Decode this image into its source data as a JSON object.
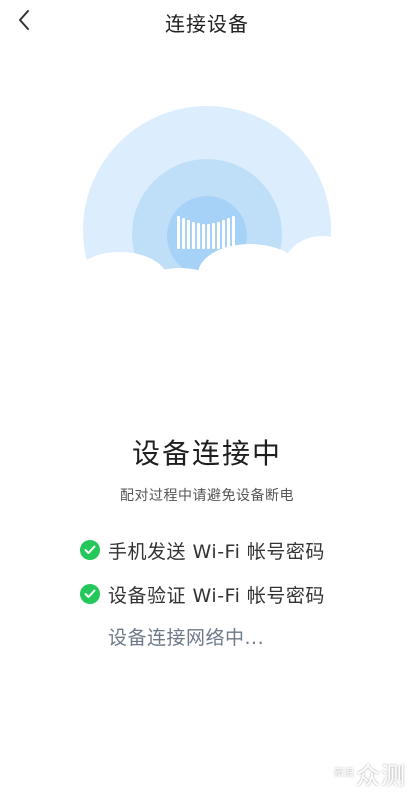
{
  "nav": {
    "title": "连接设备"
  },
  "status": {
    "title": "设备连接中",
    "subtitle": "配对过程中请避免设备断电"
  },
  "steps": [
    {
      "label": "手机发送 Wi-Fi 帐号密码",
      "state": "done"
    },
    {
      "label": "设备验证 Wi-Fi 帐号密码",
      "state": "done"
    },
    {
      "label": "设备连接网络中...",
      "state": "pending"
    }
  ],
  "watermark": {
    "small": "新浪",
    "big": "众测"
  },
  "colors": {
    "check": "#23c75a",
    "pending_text": "#6e7a8a",
    "halo_outer": "#dceefd",
    "halo_middle": "#bfdff9",
    "halo_inner": "#a6d2f7"
  }
}
